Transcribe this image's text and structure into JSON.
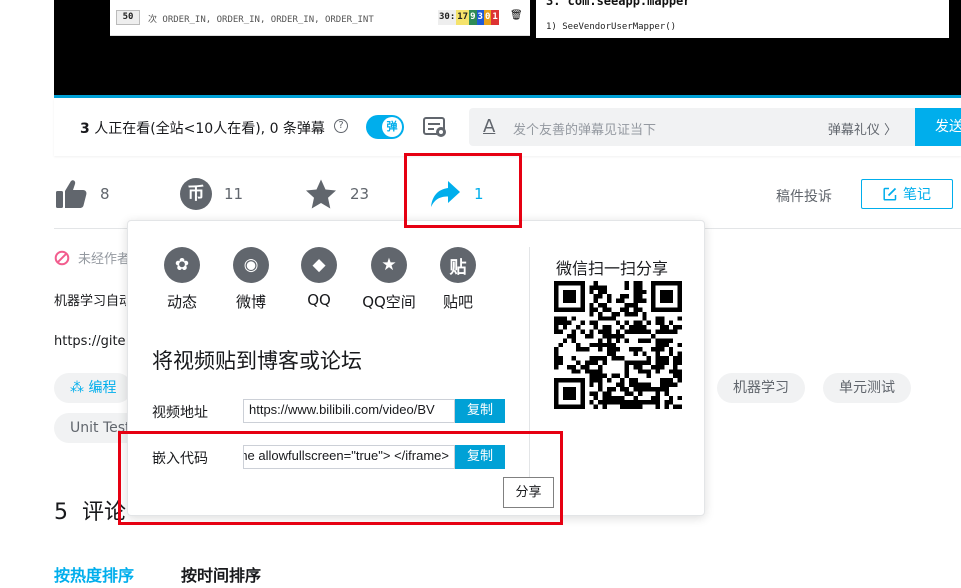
{
  "ide": {
    "count": "50",
    "code_text": "次 ORDER_IN, ORDER_IN, ORDER_IN, ORDER_INT",
    "time_parts": [
      "30:",
      "17",
      "9",
      "3",
      "0",
      "1"
    ],
    "time_colors": [
      "#eeeeee",
      "#f5e36b",
      "#2e8b57",
      "#1e5bd6",
      "#e8a21a",
      "#d33"
    ],
    "right_heading": "3. com.seeapp.mapper",
    "right_sub": "1) SeeVendorUserMapper()"
  },
  "danmaku": {
    "viewers_count": "3",
    "viewers_text": " 人正在看(全站<10人在看), 0 条弹幕",
    "toggle_label": "弹",
    "placeholder": "发个友善的弹幕见证当下",
    "etiquette": "弹幕礼仪 〉",
    "send": "发送"
  },
  "toolbar": {
    "like_count": "8",
    "coin_count": "11",
    "fav_count": "23",
    "share_count": "1",
    "coin_glyph": "币",
    "report": "稿件投诉",
    "note": "笔记"
  },
  "content": {
    "copyright": "未经作者授权，禁止转载",
    "desc_line1": "机器学习自动化测试",
    "desc_line2": "https://gitee.com",
    "tags": [
      "编程",
      "机器学习",
      "单元测试",
      "Unit Test"
    ],
    "comments_count": "5",
    "comments_label": "评论",
    "sort_hot": "按热度排序",
    "sort_time": "按时间排序"
  },
  "share_popup": {
    "targets": [
      {
        "label": "动态",
        "glyph": "✿",
        "icon": "dynamic-icon"
      },
      {
        "label": "微博",
        "glyph": "◉",
        "icon": "weibo-icon"
      },
      {
        "label": "QQ",
        "glyph": "◆",
        "icon": "qq-icon"
      },
      {
        "label": "QQ空间",
        "glyph": "★",
        "icon": "qzone-icon"
      },
      {
        "label": "贴吧",
        "glyph": "贴",
        "icon": "tieba-icon"
      }
    ],
    "wechat_title": "微信扫一扫分享",
    "blog_title": "将视频贴到博客或论坛",
    "video_url_label": "视频地址",
    "video_url_value": "https://www.bilibili.com/video/BV",
    "embed_label": "嵌入代码",
    "embed_value": "<iframe allowfullscreen=\"true\"> </iframe>",
    "copy": "复制",
    "share": "分享"
  }
}
